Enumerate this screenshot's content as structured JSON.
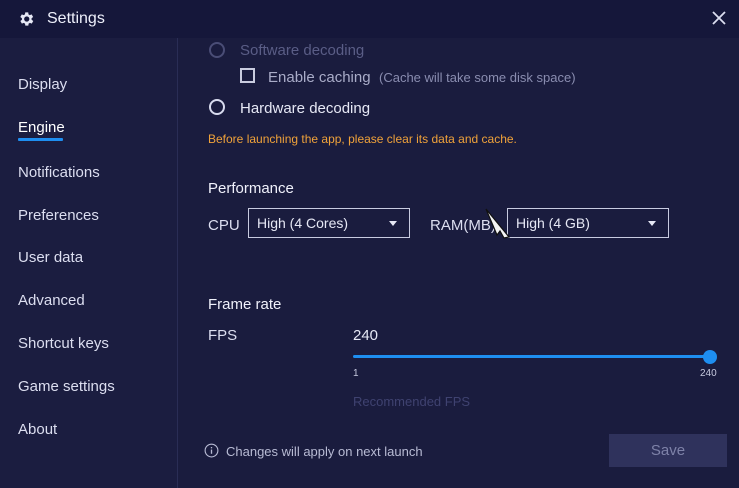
{
  "window": {
    "title": "Settings"
  },
  "sidebar": {
    "items": [
      {
        "label": "Display"
      },
      {
        "label": "Engine",
        "active": true
      },
      {
        "label": "Notifications"
      },
      {
        "label": "Preferences"
      },
      {
        "label": "User data"
      },
      {
        "label": "Advanced"
      },
      {
        "label": "Shortcut keys"
      },
      {
        "label": "Game settings"
      },
      {
        "label": "About"
      }
    ]
  },
  "engine": {
    "software_decoding": "Software decoding",
    "enable_caching": "Enable caching",
    "caching_hint": "(Cache will take some disk space)",
    "hardware_decoding": "Hardware decoding",
    "warning": "Before launching the app, please clear its data and cache."
  },
  "performance": {
    "heading": "Performance",
    "cpu_label": "CPU",
    "cpu_value": "High (4 Cores)",
    "ram_label": "RAM(MB)",
    "ram_value": "High (4 GB)"
  },
  "frame_rate": {
    "heading": "Frame rate",
    "fps_label": "FPS",
    "fps_value": "240",
    "min": "1",
    "max": "240",
    "slider_fraction": 1.0,
    "recommended": "Recommended FPS"
  },
  "footer": {
    "note": "Changes will apply on next launch",
    "save_label": "Save"
  },
  "colors": {
    "accent": "#1e8ef0",
    "warning": "#f0a23a",
    "background": "#1a1c3e"
  }
}
